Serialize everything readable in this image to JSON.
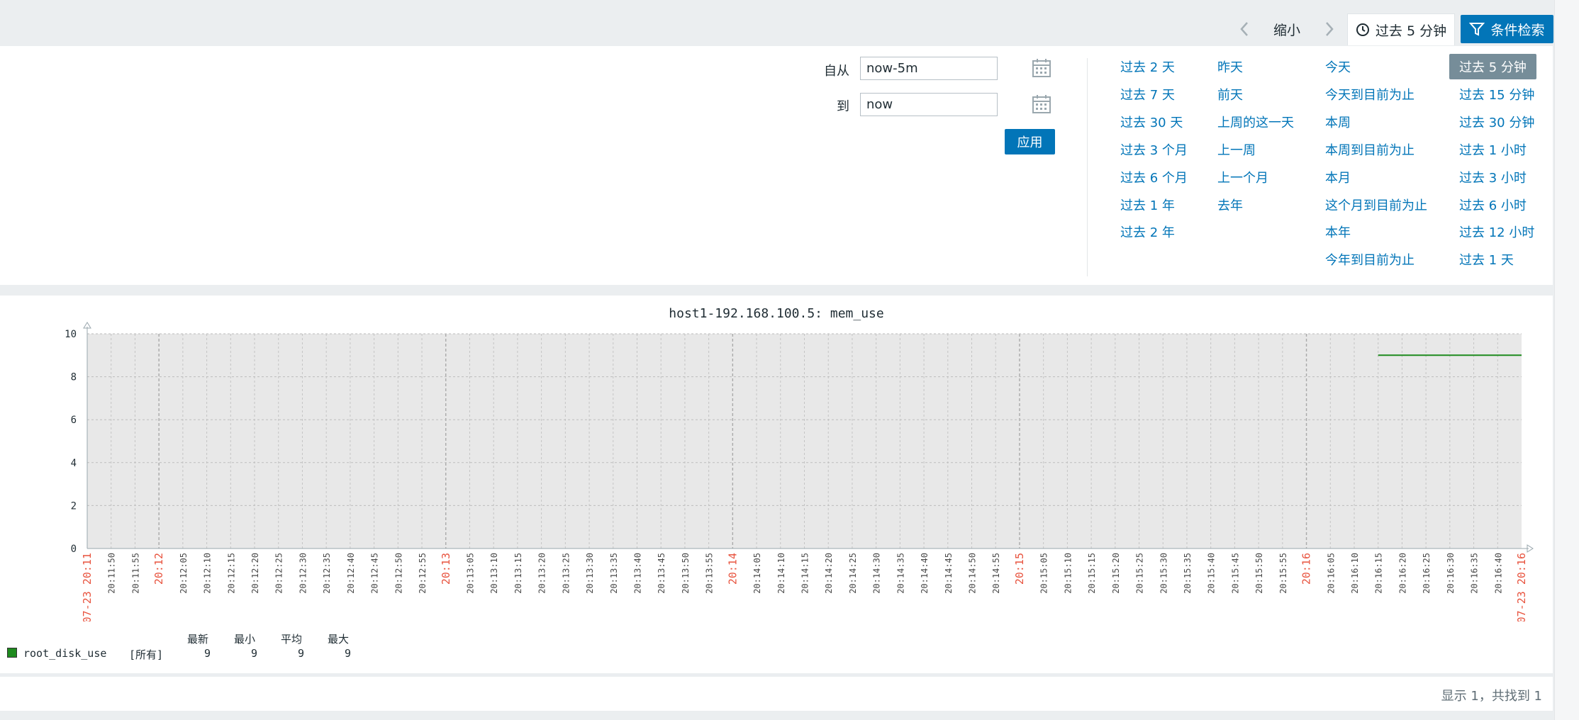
{
  "toolbar": {
    "zoom_out": "缩小",
    "time_tab": "过去 5 分钟",
    "filter": "条件检索"
  },
  "time_form": {
    "from_label": "自从",
    "from_value": "now-5m",
    "to_label": "到",
    "to_value": "now",
    "apply": "应用"
  },
  "quick_ranges": {
    "col1": [
      "过去 2 天",
      "过去 7 天",
      "过去 30 天",
      "过去 3 个月",
      "过去 6 个月",
      "过去 1 年",
      "过去 2 年"
    ],
    "col2": [
      "昨天",
      "前天",
      "上周的这一天",
      "上一周",
      "上一个月",
      "去年"
    ],
    "col3": [
      "今天",
      "今天到目前为止",
      "本周",
      "本周到目前为止",
      "本月",
      "这个月到目前为止",
      "本年",
      "今年到目前为止"
    ],
    "col4": [
      "过去 5 分钟",
      "过去 15 分钟",
      "过去 30 分钟",
      "过去 1 小时",
      "过去 3 小时",
      "过去 6 小时",
      "过去 12 小时",
      "过去 1 天"
    ],
    "active": "过去 5 分钟"
  },
  "graph": {
    "title": "host1-192.168.100.5: mem_use"
  },
  "chart_data": {
    "type": "line",
    "title": "host1-192.168.100.5: mem_use",
    "ylim": [
      0,
      10
    ],
    "y_ticks": [
      "0",
      "2",
      "4",
      "6",
      "8",
      "10"
    ],
    "x_ticks": [
      "07-23 20:11",
      "20:11:50",
      "20:11:55",
      "20:12",
      "20:12:05",
      "20:12:10",
      "20:12:15",
      "20:12:20",
      "20:12:25",
      "20:12:30",
      "20:12:35",
      "20:12:40",
      "20:12:45",
      "20:12:50",
      "20:12:55",
      "20:13",
      "20:13:05",
      "20:13:10",
      "20:13:15",
      "20:13:20",
      "20:13:25",
      "20:13:30",
      "20:13:35",
      "20:13:40",
      "20:13:45",
      "20:13:50",
      "20:13:55",
      "20:14",
      "20:14:05",
      "20:14:10",
      "20:14:15",
      "20:14:20",
      "20:14:25",
      "20:14:30",
      "20:14:35",
      "20:14:40",
      "20:14:45",
      "20:14:50",
      "20:14:55",
      "20:15",
      "20:15:05",
      "20:15:10",
      "20:15:15",
      "20:15:20",
      "20:15:25",
      "20:15:30",
      "20:15:35",
      "20:15:40",
      "20:15:45",
      "20:15:50",
      "20:15:55",
      "20:16",
      "20:16:05",
      "20:16:10",
      "20:16:15",
      "20:16:20",
      "20:16:25",
      "20:16:30",
      "20:16:35",
      "20:16:40",
      "07-23 20:16"
    ],
    "x_tick_colors": {
      "major": "#e8533e",
      "minor": "#4a4a4a"
    },
    "grid": true,
    "background_color": "#e8e8e8",
    "series": [
      {
        "name": "root_disk_use",
        "color": "#1e8a1e",
        "x": [
          "20:16:15",
          "20:16:45"
        ],
        "values": [
          9,
          9
        ]
      }
    ]
  },
  "legend": {
    "headers": [
      "最新",
      "最小",
      "平均",
      "最大"
    ],
    "item_name": "root_disk_use",
    "item_scope": "[所有]",
    "values": [
      "9",
      "9",
      "9",
      "9"
    ],
    "color": "#1e8a1e"
  },
  "footer": {
    "count_text": "显示 1，共找到 1"
  }
}
